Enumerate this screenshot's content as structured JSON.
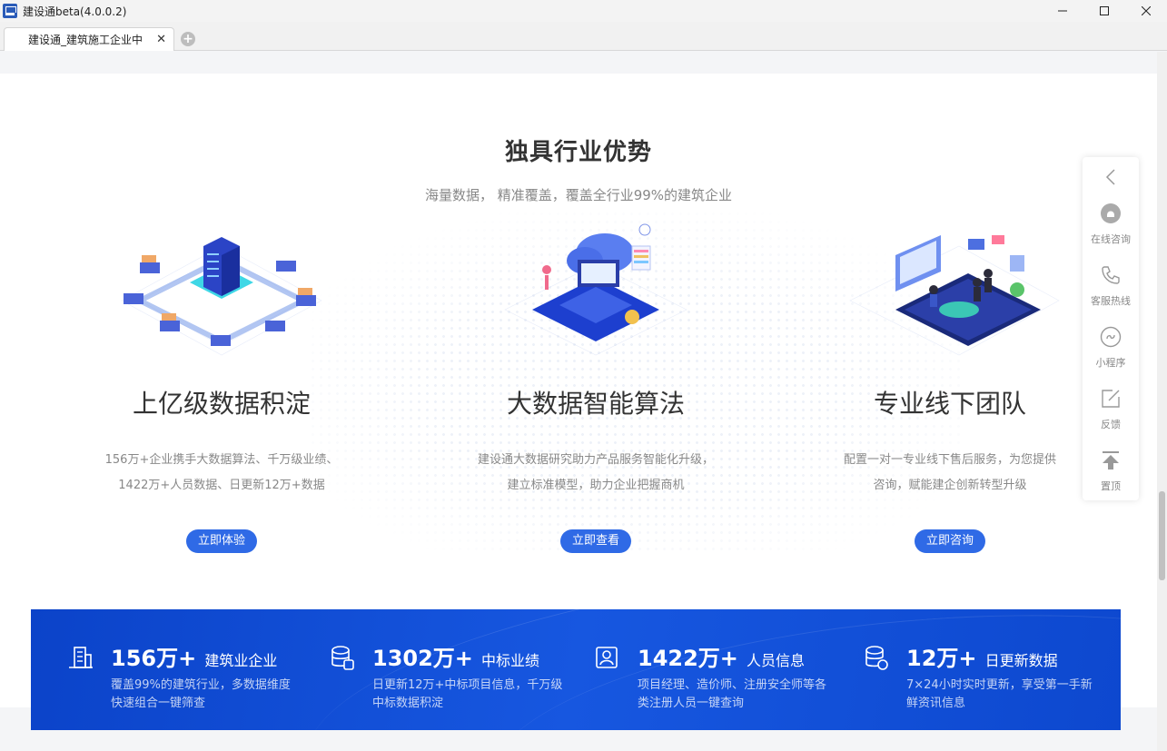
{
  "window": {
    "title": "建设通beta(4.0.0.2)"
  },
  "tabs": [
    {
      "label": "建设通_建筑施工企业中"
    }
  ],
  "section": {
    "title": "独具行业优势",
    "subtitle": "海量数据， 精准覆盖，覆盖全行业99%的建筑企业"
  },
  "features": [
    {
      "title": "上亿级数据积淀",
      "desc_line1": "156万+企业携手大数据算法、千万级业绩、",
      "desc_line2": "1422万+人员数据、日更新12万+数据",
      "button": "立即体验",
      "icon": "server-network-illustration"
    },
    {
      "title": "大数据智能算法",
      "desc_line1": "建设通大数据研究助力产品服务智能化升级，",
      "desc_line2": "建立标准模型，助力企业把握商机",
      "button": "立即查看",
      "icon": "cloud-computing-illustration"
    },
    {
      "title": "专业线下团队",
      "desc_line1": "配置一对一专业线下售后服务，为您提供",
      "desc_line2": "咨询，赋能建企创新转型升级",
      "button": "立即咨询",
      "icon": "team-meeting-illustration"
    }
  ],
  "stats": [
    {
      "number": "156万+",
      "label": "建筑业企业",
      "desc": "覆盖99%的建筑行业，多数据维度快速组合一键筛查",
      "icon": "building-icon"
    },
    {
      "number": "1302万+",
      "label": "中标业绩",
      "desc": "日更新12万+中标项目信息，千万级中标数据积淀",
      "icon": "database-icon"
    },
    {
      "number": "1422万+",
      "label": "人员信息",
      "desc": "项目经理、造价师、注册安全师等各类注册人员一键查询",
      "icon": "person-card-icon"
    },
    {
      "number": "12万+",
      "label": "日更新数据",
      "desc": "7×24小时实时更新，享受第一手新鲜资讯信息",
      "icon": "database-refresh-icon"
    }
  ],
  "sidebar": {
    "items": [
      {
        "label": "在线咨询",
        "icon": "chat-bubble-icon"
      },
      {
        "label": "客服热线",
        "icon": "phone-icon"
      },
      {
        "label": "小程序",
        "icon": "mini-program-icon"
      },
      {
        "label": "反馈",
        "icon": "edit-icon"
      },
      {
        "label": "置顶",
        "icon": "back-to-top-icon"
      }
    ]
  },
  "colors": {
    "primary": "#2f6ae6",
    "band": "#1352dc"
  }
}
